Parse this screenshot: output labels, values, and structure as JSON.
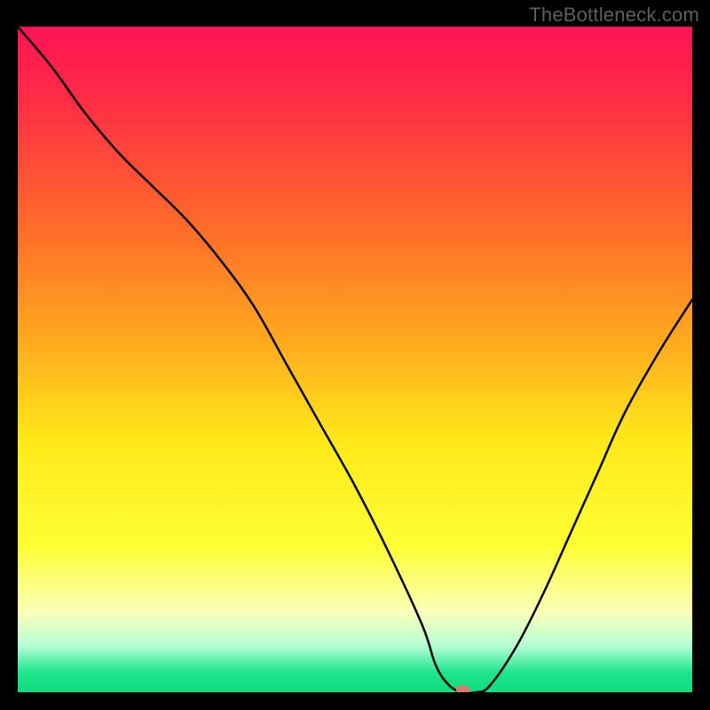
{
  "watermark": "TheBottleneck.com",
  "chart_data": {
    "type": "line",
    "title": "",
    "xlabel": "",
    "ylabel": "",
    "xlim": [
      0,
      100
    ],
    "ylim": [
      0,
      100
    ],
    "background_gradient": {
      "stops": [
        {
          "pos": 0.0,
          "color": "#ff1255"
        },
        {
          "pos": 0.12,
          "color": "#ff3044"
        },
        {
          "pos": 0.3,
          "color": "#ff6a2a"
        },
        {
          "pos": 0.48,
          "color": "#ffad1e"
        },
        {
          "pos": 0.62,
          "color": "#ffe81a"
        },
        {
          "pos": 0.78,
          "color": "#feff33"
        },
        {
          "pos": 0.88,
          "color": "#faffb8"
        },
        {
          "pos": 0.93,
          "color": "#b6ffd8"
        },
        {
          "pos": 0.97,
          "color": "#1fe58c"
        },
        {
          "pos": 1.0,
          "color": "#0ddc7e"
        }
      ]
    },
    "x": [
      0,
      5,
      10,
      15,
      20,
      25,
      30,
      35,
      40,
      45,
      50,
      55,
      60,
      62,
      64,
      66,
      68,
      70,
      74,
      78,
      82,
      86,
      90,
      95,
      100
    ],
    "values": [
      100,
      94,
      87,
      81,
      76,
      71,
      65,
      58,
      49,
      40,
      31,
      21,
      10,
      4,
      1,
      0,
      0,
      1,
      7,
      15,
      24,
      33,
      42,
      51,
      59
    ],
    "marker": {
      "x": 66,
      "y": 0,
      "color": "#d9796f",
      "rx": 8,
      "ry": 5,
      "rotation_deg": 5
    }
  }
}
